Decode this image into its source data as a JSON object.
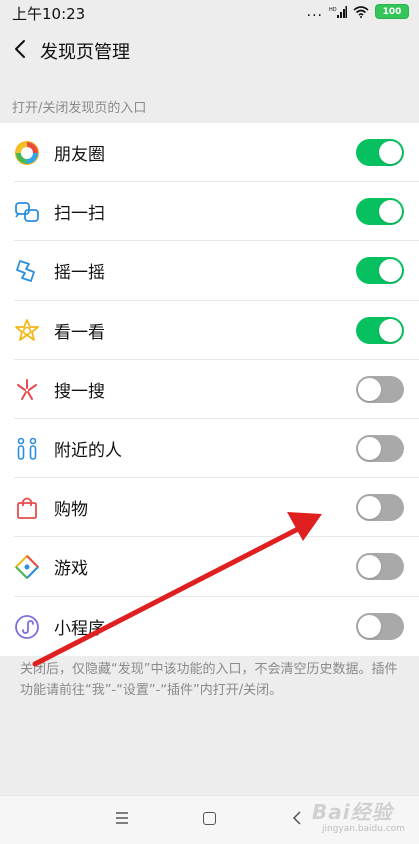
{
  "status_bar": {
    "time": "上午10:23",
    "signal_dots": "...",
    "battery": "100",
    "icons": [
      "signal-hd-icon",
      "wifi-icon",
      "battery-icon"
    ]
  },
  "header": {
    "back_icon": "chevron-left-icon",
    "title": "发现页管理"
  },
  "section_label": "打开/关闭发现页的入口",
  "items": [
    {
      "label": "朋友圈",
      "icon": "moments-icon",
      "on": true
    },
    {
      "label": "扫一扫",
      "icon": "scan-icon",
      "on": true
    },
    {
      "label": "摇一摇",
      "icon": "shake-icon",
      "on": true
    },
    {
      "label": "看一看",
      "icon": "top-stories-icon",
      "on": true
    },
    {
      "label": "搜一搜",
      "icon": "search-icon",
      "on": false
    },
    {
      "label": "附近的人",
      "icon": "people-nearby-icon",
      "on": false
    },
    {
      "label": "购物",
      "icon": "shopping-bag-icon",
      "on": false
    },
    {
      "label": "游戏",
      "icon": "games-icon",
      "on": false
    },
    {
      "label": "小程序",
      "icon": "mini-program-icon",
      "on": false
    }
  ],
  "note": "关闭后，仅隐藏“发现”中该功能的入口，不会清空历史数据。插件功能请前往“我”-“设置”-“插件”内打开/关闭。",
  "watermark": {
    "main": "Bai经验",
    "sub": "jingyan.baidu.com"
  },
  "colors": {
    "toggle_on": "#07c160",
    "toggle_off": "#a9a9a9",
    "arrow": "#e02020"
  }
}
